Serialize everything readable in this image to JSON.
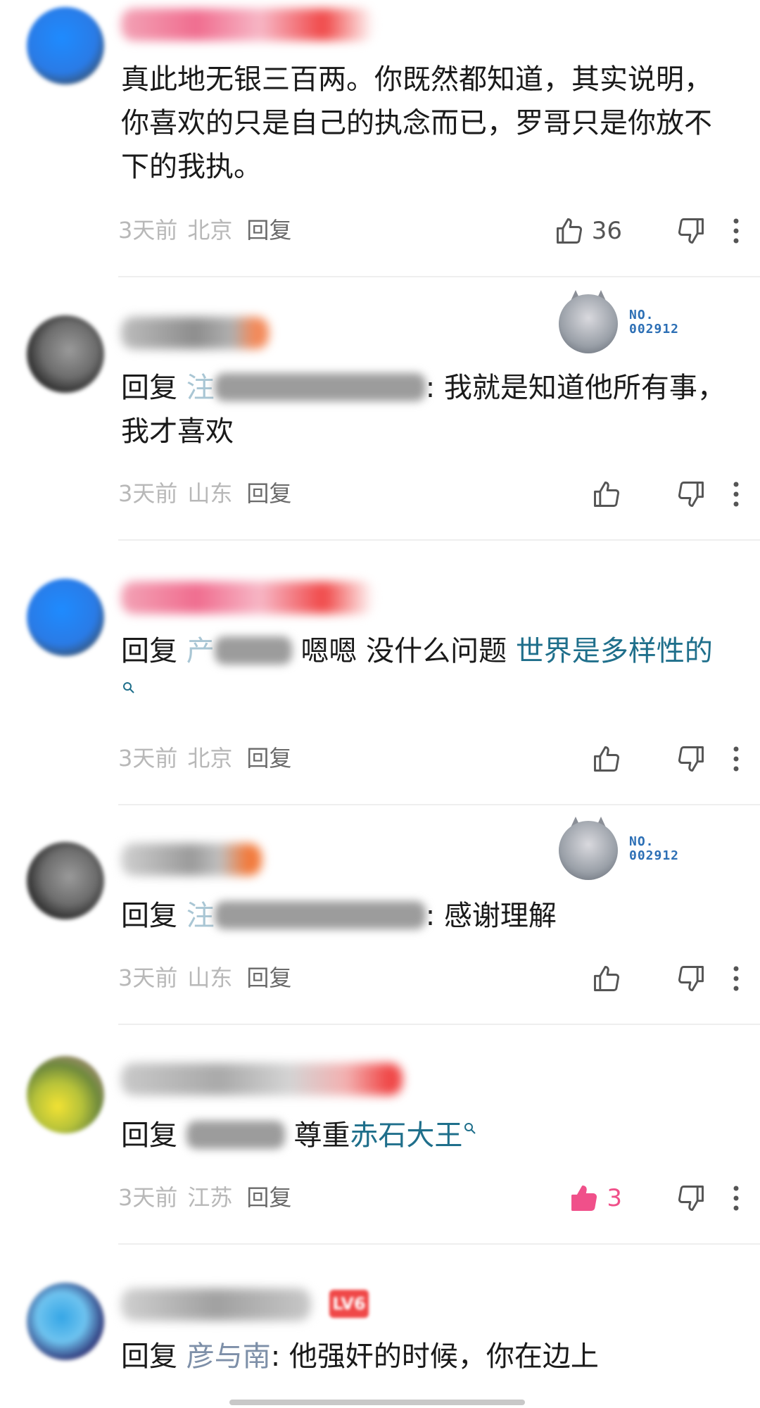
{
  "comments": [
    {
      "text": "真此地无银三百两。你既然都知道，其实说明，你喜欢的只是自己的执念而已，罗哥只是你放不下的我执。",
      "time": "3天前",
      "location": "北京",
      "reply_label": "回复",
      "likes": "36",
      "liked": false
    },
    {
      "reply_prefix": "回复",
      "name_initial": "注",
      "text": ": 我就是知道他所有事，我才喜欢",
      "time": "3天前",
      "location": "山东",
      "reply_label": "回复",
      "medal_no": "NO.",
      "medal_id": "002912"
    },
    {
      "reply_prefix": "回复",
      "name_initial": "产",
      "text": "嗯嗯 没什么问题",
      "link": "世界是多样性的",
      "time": "3天前",
      "location": "北京",
      "reply_label": "回复"
    },
    {
      "reply_prefix": "回复",
      "name_initial": "注",
      "text": ": 感谢理解",
      "time": "3天前",
      "location": "山东",
      "reply_label": "回复",
      "medal_no": "NO.",
      "medal_id": "002912"
    },
    {
      "reply_prefix": "回复",
      "text": "尊重",
      "link": "赤石大王",
      "time": "3天前",
      "location": "江苏",
      "reply_label": "回复",
      "likes": "3",
      "liked": true
    },
    {
      "reply_prefix": "回复",
      "reply_target": "彦与南",
      "text": ": 他强奸的时候，你在边上",
      "level_badge": "LV6"
    }
  ],
  "colors": {
    "link": "#1f6f8b",
    "liked": "#f0508a",
    "meta": "#b8b8b8"
  },
  "icons": [
    "thumbs-up-icon",
    "thumbs-down-icon",
    "more-vertical-icon",
    "search-icon"
  ]
}
